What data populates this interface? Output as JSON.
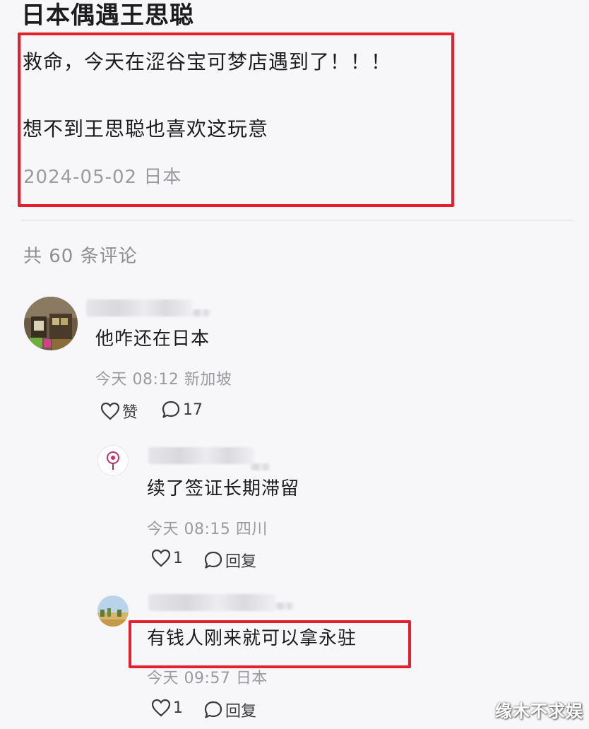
{
  "post": {
    "title": "日本偶遇王思聪",
    "line1": "救命，今天在涩谷宝可梦店遇到了！！！",
    "line2": "想不到王思聪也喜欢这玩意",
    "meta": "2024-05-02 日本"
  },
  "comments_header": "共 60 条评论",
  "comments": [
    {
      "text": "他咋还在日本",
      "meta": "今天 08:12 新加坡",
      "like_label": "赞",
      "reply_count": "17"
    }
  ],
  "replies": [
    {
      "text": "续了签证长期滞留",
      "meta": "今天 08:15 四川",
      "like_count": "1",
      "reply_label": "回复"
    },
    {
      "text": "有钱人刚来就可以拿永驻",
      "meta": "今天 09:57 日本",
      "like_count": "1",
      "reply_label": "回复"
    }
  ],
  "watermark": "缘木不求娱",
  "colors": {
    "highlight": "#e5202e",
    "meta_gray": "#9a9a9f",
    "background": "#f7f7f9"
  }
}
